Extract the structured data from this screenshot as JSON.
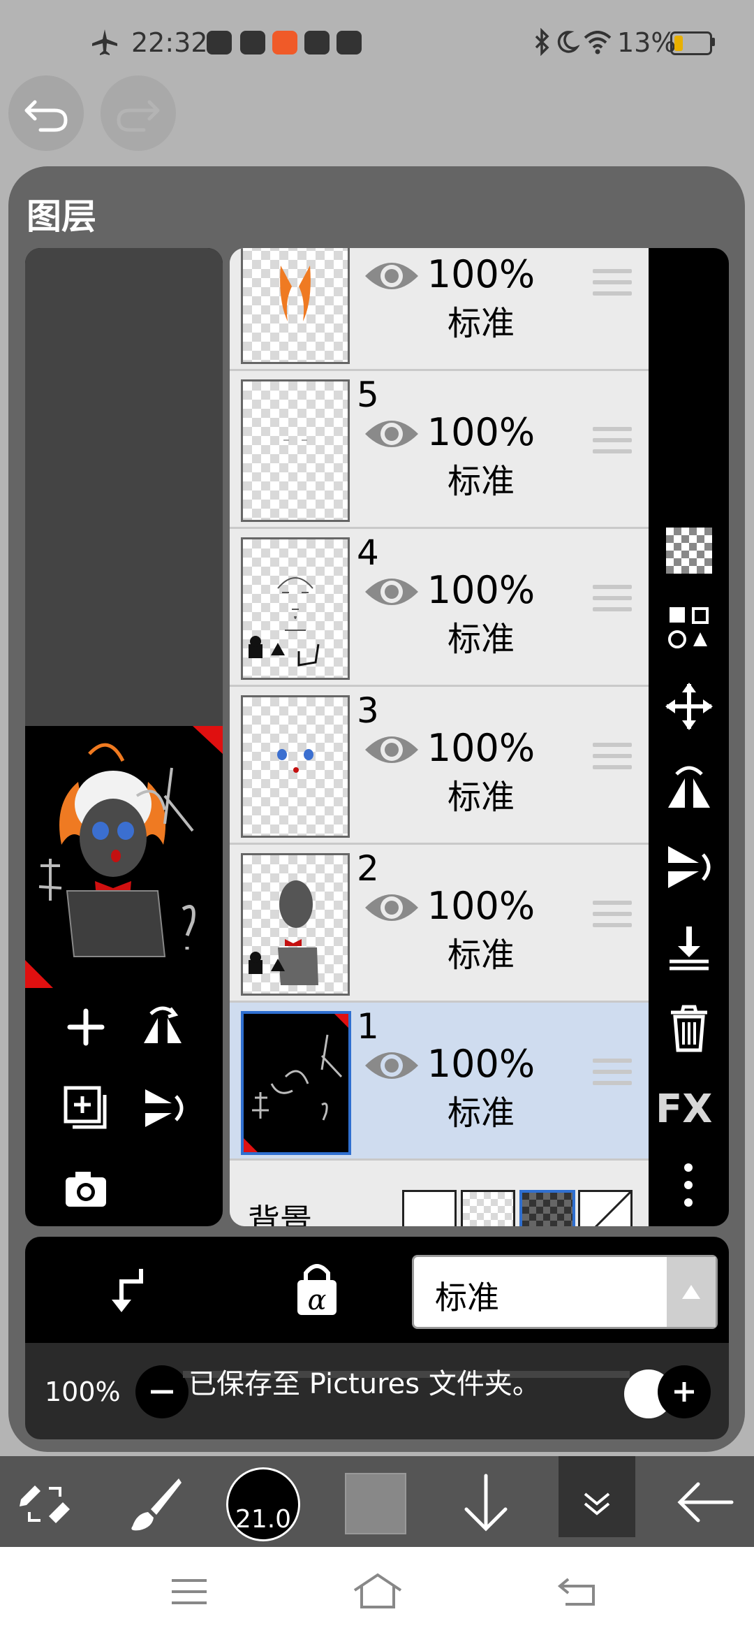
{
  "status": {
    "time": "22:32",
    "battery": "13%"
  },
  "panel": {
    "title": "图层"
  },
  "layers": [
    {
      "number": "",
      "opacity": "100%",
      "blend": "标准",
      "selected": false
    },
    {
      "number": "5",
      "opacity": "100%",
      "blend": "标准",
      "selected": false
    },
    {
      "number": "4",
      "opacity": "100%",
      "blend": "标准",
      "selected": false
    },
    {
      "number": "3",
      "opacity": "100%",
      "blend": "标准",
      "selected": false
    },
    {
      "number": "2",
      "opacity": "100%",
      "blend": "标准",
      "selected": false
    },
    {
      "number": "1",
      "opacity": "100%",
      "blend": "标准",
      "selected": true
    }
  ],
  "background": {
    "label": "背景"
  },
  "sidebar": {
    "fx_label": "FX"
  },
  "controls": {
    "blend_mode": "标准"
  },
  "zoom": {
    "value": "100%",
    "toast": "已保存至 Pictures 文件夹。"
  },
  "toolbar": {
    "brush_size": "21.0"
  },
  "colors": {
    "accent": "#2f6fd0",
    "selected_row": "#cfdcef",
    "panel": "#656565"
  }
}
